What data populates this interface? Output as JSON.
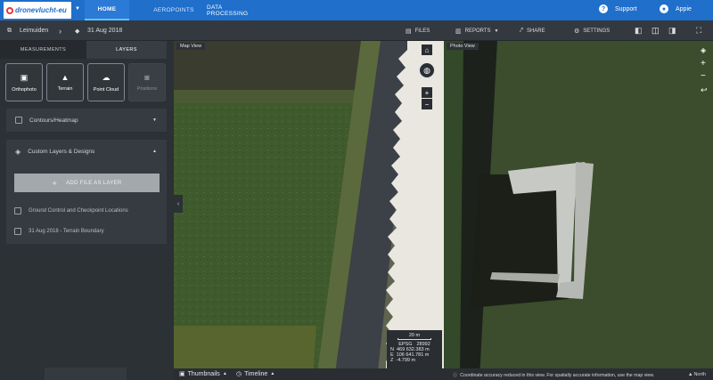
{
  "header": {
    "logo_text": "dronevlucht-eu",
    "nav": [
      "HOME",
      "AEROPOINTS",
      "DATA PROCESSING"
    ],
    "support_label": "Support",
    "user_name": "Appie"
  },
  "subbar": {
    "project": "Leimuiden",
    "date": "31 Aug 2018",
    "files": "FILES",
    "reports": "REPORTS",
    "share": "SHARE",
    "settings": "SETTINGS"
  },
  "sidebar": {
    "tabs": [
      "MEASUREMENTS",
      "LAYERS"
    ],
    "layer_buttons": [
      "Orthophoto",
      "Terrain",
      "Point Cloud",
      "Positions"
    ],
    "sections": [
      "Contours/Heatmap",
      "Custom Layers & Designs"
    ],
    "add_button": "ADD FILE AS LAYER",
    "layers": [
      "Ground Control and Checkpoint Locations",
      "31 Aug 2018 - Terrain Boundary"
    ]
  },
  "map": {
    "label": "Map View",
    "scale": "20 m",
    "epsg_label": "EPSG",
    "epsg": "28992",
    "n_label": "N",
    "n": "469 632.383 m",
    "e_label": "E",
    "e": "106 641.781 m",
    "z_label": "Z",
    "z": "-4.799 m"
  },
  "photo": {
    "label": "Photo View",
    "notice": "Coordinate accuracy reduced in this view. For spatially accurate information, use the map view.",
    "north": "North"
  },
  "bottom": {
    "thumbnails": "Thumbnails",
    "timeline": "Timeline"
  },
  "colors": {
    "brand": "#1f6fcb",
    "panel": "#2c3136",
    "accent": "#5fc4ff"
  }
}
